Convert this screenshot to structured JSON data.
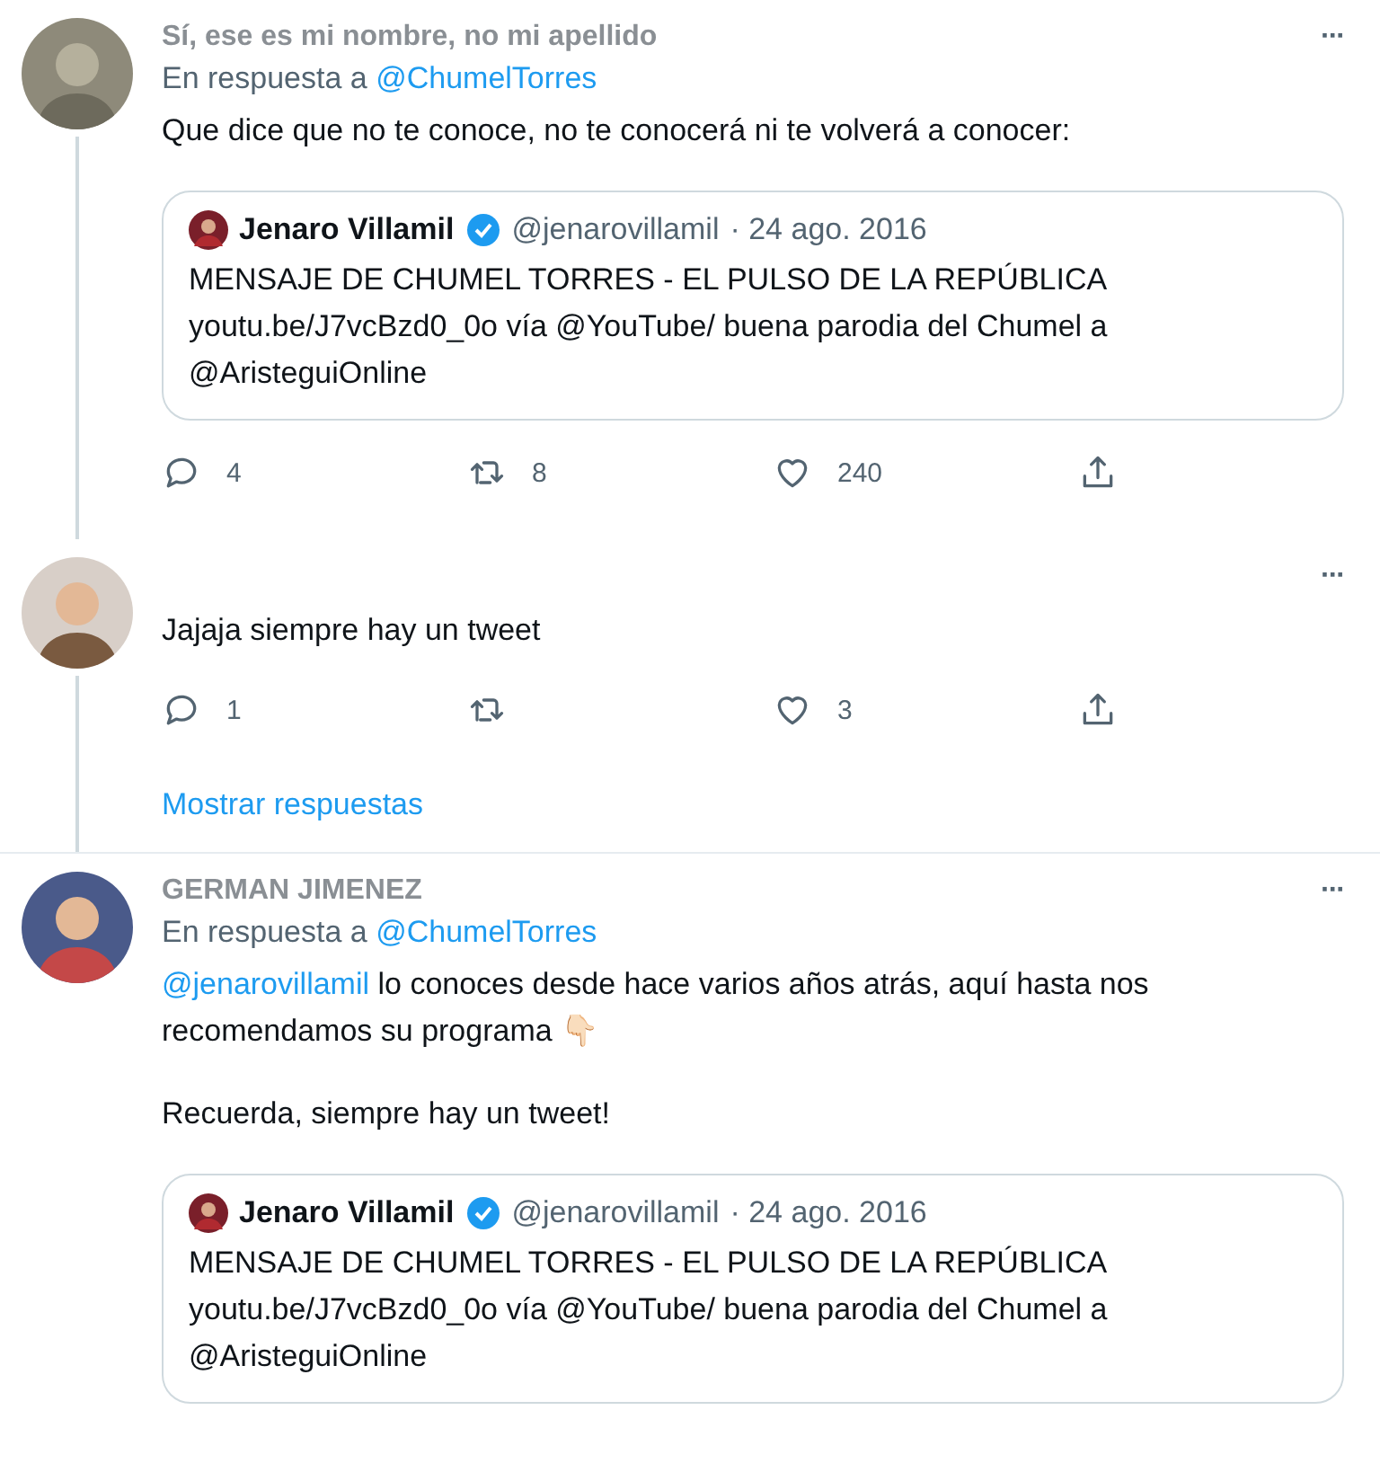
{
  "tweets": [
    {
      "header": "Sí, ese es mi nombre, no mi apellido",
      "thread_line": true,
      "reply_label": "En respuesta a",
      "reply_handle": "@ChumelTorres",
      "more": "···",
      "paragraphs": [
        [
          {
            "kind": "text",
            "text": "Que dice que no te conoce, no te conocerá ni te volverá a conocer:"
          }
        ]
      ],
      "quote": {
        "name": "Jenaro Villamil",
        "handle": "@jenarovillamil",
        "date": "· 24 ago. 2016",
        "lines": [
          "MENSAJE DE CHUMEL TORRES - EL PULSO DE LA REPÚBLICA",
          "youtu.be/J7vcBzd0_0o vía @YouTube/ buena parodia del Chumel a",
          "@AristeguiOnline"
        ]
      },
      "actions": [
        {
          "kind": "reply",
          "count": "4"
        },
        {
          "kind": "retweet",
          "count": "8"
        },
        {
          "kind": "like",
          "count": "240"
        },
        {
          "kind": "share"
        }
      ]
    },
    {
      "thread_line": true,
      "more": "···",
      "paragraphs": [
        [
          {
            "kind": "text",
            "text": "Jajaja siempre hay un tweet"
          }
        ]
      ],
      "actions": [
        {
          "kind": "reply",
          "count": "1"
        },
        {
          "kind": "retweet"
        },
        {
          "kind": "like",
          "count": "3"
        },
        {
          "kind": "share"
        }
      ],
      "show_replies": "Mostrar respuestas"
    },
    {
      "header": "GERMAN JIMENEZ",
      "thread_line": false,
      "reply_label": "En respuesta a",
      "reply_handle": "@ChumelTorres",
      "more": "···",
      "paragraphs": [
        [
          {
            "kind": "mention",
            "text": "@jenarovillamil"
          },
          {
            "kind": "text",
            "text": " lo conoces desde hace varios años atrás, aquí hasta nos recomendamos su programa 👇🏻"
          }
        ],
        [
          {
            "kind": "text",
            "text": "Recuerda, siempre hay un tweet!"
          }
        ]
      ],
      "quote": {
        "name": "Jenaro Villamil",
        "handle": "@jenarovillamil",
        "date": "· 24 ago. 2016",
        "lines": [
          "MENSAJE DE CHUMEL TORRES - EL PULSO DE LA REPÚBLICA",
          "youtu.be/J7vcBzd0_0o vía @YouTube/ buena parodia del Chumel a",
          "@AristeguiOnline"
        ]
      }
    }
  ]
}
